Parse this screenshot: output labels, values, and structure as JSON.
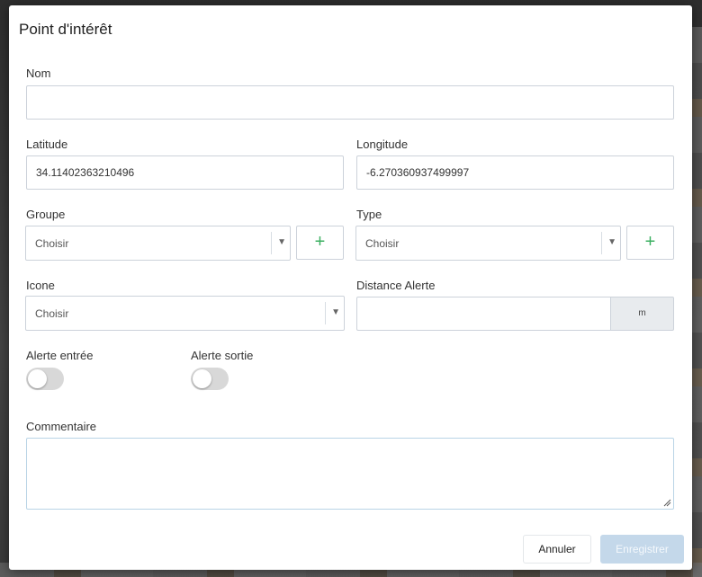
{
  "dialog": {
    "title": "Point d'intérêt"
  },
  "fields": {
    "name": {
      "label": "Nom",
      "value": ""
    },
    "latitude": {
      "label": "Latitude",
      "value": "34.11402363210496"
    },
    "longitude": {
      "label": "Longitude",
      "value": "-6.270360937499997"
    },
    "group": {
      "label": "Groupe",
      "selected": "Choisir",
      "add": "+"
    },
    "type": {
      "label": "Type",
      "selected": "Choisir",
      "add": "+"
    },
    "icon": {
      "label": "Icone",
      "selected": "Choisir"
    },
    "distance_alert": {
      "label": "Distance Alerte",
      "value": "",
      "unit": "m"
    },
    "alert_entry": {
      "label": "Alerte entrée",
      "on": false
    },
    "alert_exit": {
      "label": "Alerte sortie",
      "on": false
    },
    "comment": {
      "label": "Commentaire",
      "value": ""
    }
  },
  "caret": "▼",
  "buttons": {
    "cancel": "Annuler",
    "save": "Enregistrer"
  },
  "colors": {
    "add_icon": "#3cb062",
    "save_disabled": "#c4d8ea",
    "toggle_off": "#d8d8d8"
  }
}
